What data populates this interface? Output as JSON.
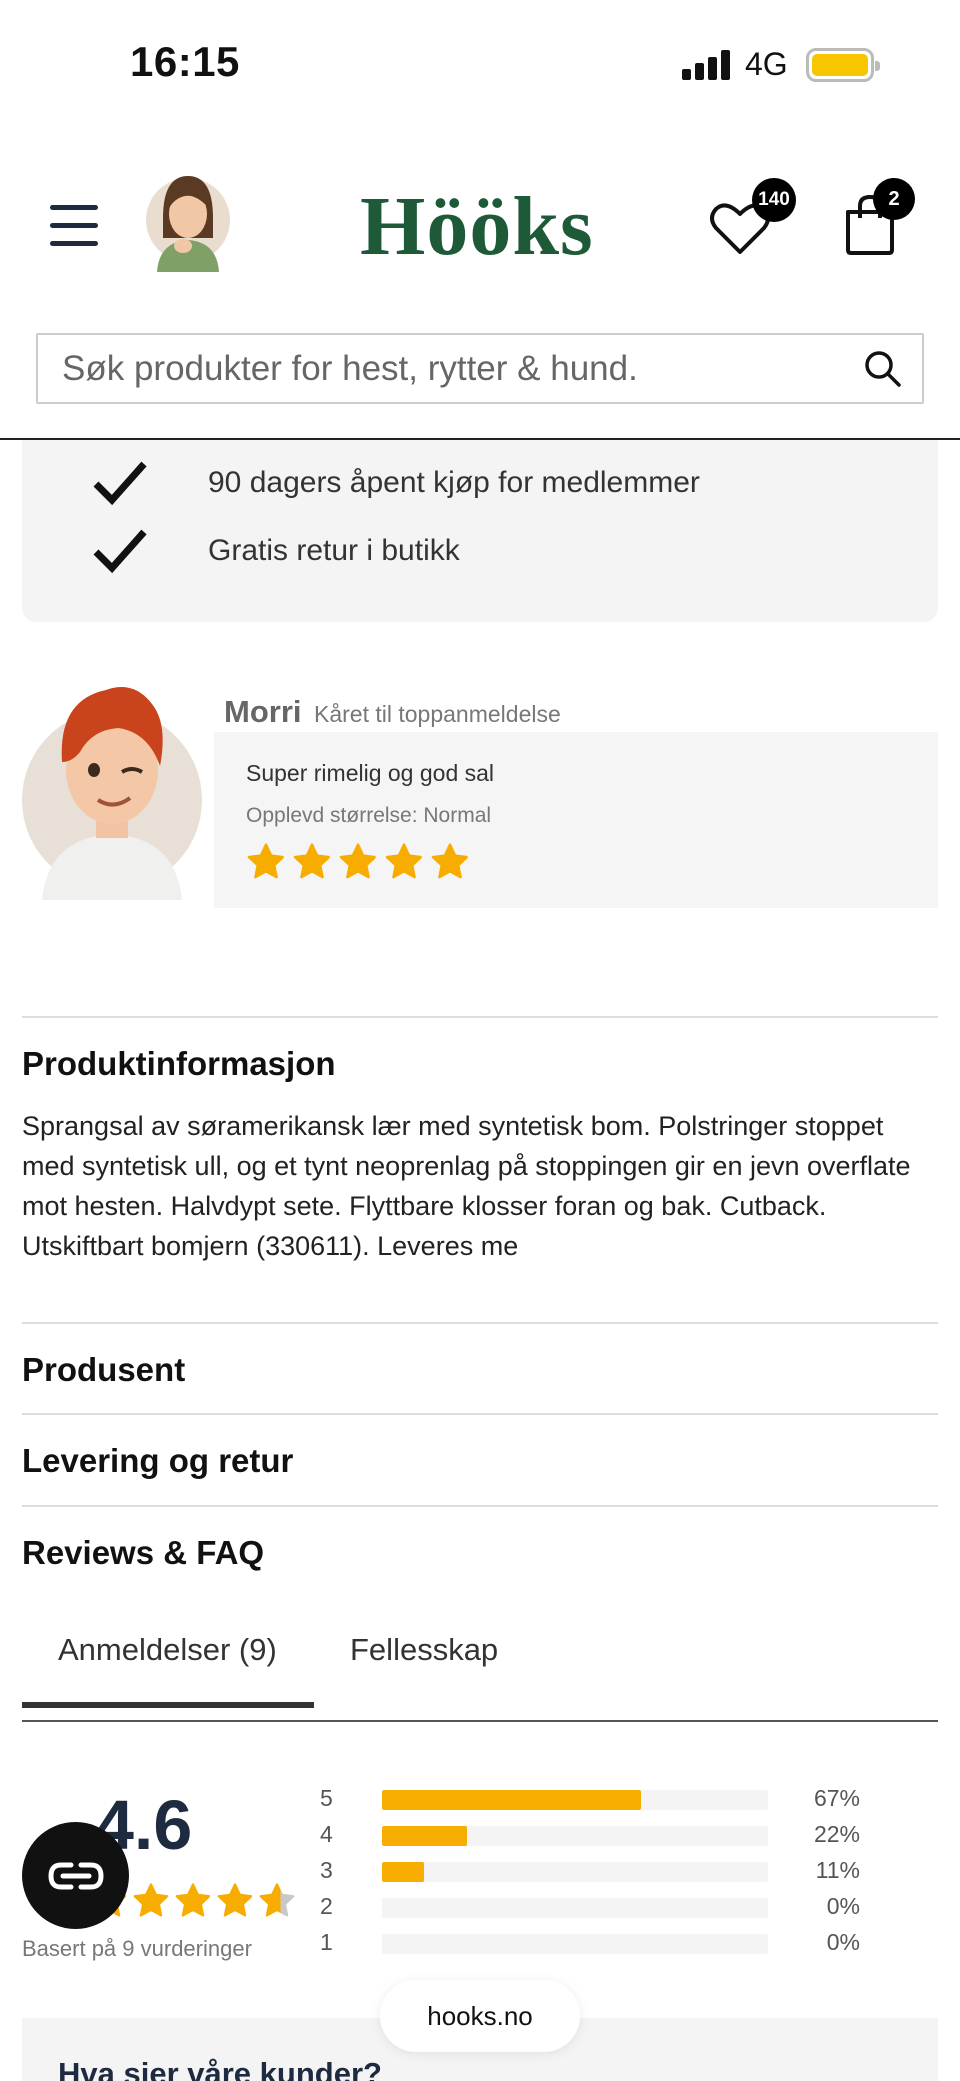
{
  "status_bar": {
    "time": "16:15",
    "network": "4G"
  },
  "header": {
    "logo": "Hööks",
    "favorites_count": "140",
    "cart_count": "2"
  },
  "search": {
    "placeholder": "Søk produkter for hest, rytter & hund."
  },
  "perks": [
    "90 dagers åpent kjøp for medlemmer",
    "Gratis retur i butikk"
  ],
  "featured_review": {
    "author": "Morri",
    "badge": "Kåret til toppanmeldelse",
    "title": "Super rimelig og god sal",
    "size_experienced": "Opplevd størrelse: Normal",
    "rating": 5
  },
  "product_info": {
    "heading": "Produktinformasjon",
    "text": "Sprangsal av søramerikansk lær med syntetisk bom. Polstringer stoppet med syntetisk ull, og et tynt neoprenlag på stoppingen gir en jevn overflate mot hesten. Halvdypt sete. Flyttbare klosser foran og bak. Cutback. Utskiftbart bomjern (330611). Leveres me"
  },
  "sections": {
    "producer": "Produsent",
    "delivery": "Levering og retur",
    "reviews_faq": "Reviews & FAQ"
  },
  "tabs": [
    {
      "label": "Anmeldelser (9)",
      "active": true
    },
    {
      "label": "Fellesskap",
      "active": false
    }
  ],
  "rating_summary": {
    "average": "4.6",
    "average_value": 4.6,
    "based_on": "Basert på 9 vurderinger",
    "distribution": [
      {
        "stars": "5",
        "percent": "67%",
        "value": 67
      },
      {
        "stars": "4",
        "percent": "22%",
        "value": 22
      },
      {
        "stars": "3",
        "percent": "11%",
        "value": 11
      },
      {
        "stars": "2",
        "percent": "0%",
        "value": 0
      },
      {
        "stars": "1",
        "percent": "0%",
        "value": 0
      }
    ]
  },
  "url_pill": "hooks.no",
  "customers_heading": "Hva sier våre kunder?",
  "colors": {
    "brand_green": "#1f5a38",
    "star": "#f7ad00",
    "navy": "#1e2a40"
  }
}
